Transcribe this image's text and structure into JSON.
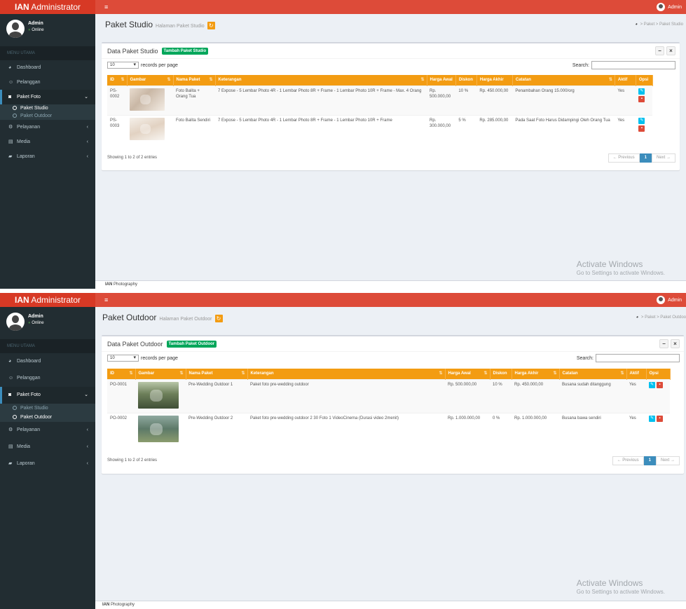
{
  "app": {
    "brand_bold": "IAN",
    "brand_rest": " Administrator",
    "hamburger": "≡",
    "top_user": "Admin"
  },
  "sidebar": {
    "user_name": "Admin",
    "user_status": "Online",
    "header": "MENU UTAMA",
    "items": {
      "dashboard": "Dashboard",
      "pelanggan": "Pelanggan",
      "paket_foto": "Paket Foto",
      "paket_studio": "Paket Studio",
      "paket_outdoor": "Paket Outdoor",
      "pelayanan": "Pelayanan",
      "media": "Media",
      "laporan": "Laporan"
    }
  },
  "common": {
    "records_per_page": "records per page",
    "length_value": "10",
    "search_label": "Search:",
    "minimize": "−",
    "close": "×",
    "previous": "← Previous",
    "next": "Next →",
    "page": "1",
    "bc_paket": "Paket",
    "watermark_title": "Activate Windows",
    "watermark_sub": "Go to Settings to activate Windows.",
    "footer_bold": "IAN",
    "footer_rest": " Photography"
  },
  "studio": {
    "title": "Paket Studio",
    "subtitle": "Halaman Paket Studio",
    "breadcrumb_last": "Paket Studio",
    "box_title": "Data Paket Studio",
    "add_button": "Tambah Paket Studio",
    "columns": [
      "ID",
      "Gambar",
      "Nama Paket",
      "Keterangan",
      "Harga Awal",
      "Diskon",
      "Harga Akhir",
      "Catatan",
      "Aktif",
      "Opsi"
    ],
    "rows": [
      {
        "id": "PS-0002",
        "nama": "Foto Balita + Orang Tua",
        "keterangan": "7 Expose - 5 Lembar Photo 4R - 1 Lembar Photo 8R + Frame - 1 Lembar Photo 10R + Frame - Max. 4 Orang",
        "harga_awal": "Rp. 500.000,00",
        "diskon": "10 %",
        "harga_akhir": "Rp. 450.000,00",
        "catatan": "Penambahan Orang 15.000/org",
        "aktif": "Yes"
      },
      {
        "id": "PS-0003",
        "nama": "Foto Balita Sendiri",
        "keterangan": "7 Expose - 5 Lembar Photo 4R - 1 Lembar Photo 8R + Frame - 1 Lembar Photo 10R + Frame",
        "harga_awal": "Rp. 300.000,00",
        "diskon": "5 %",
        "harga_akhir": "Rp. 285.000,00",
        "catatan": "Pada Saat Foto Harus Didampingi Oleh Orang Tua",
        "aktif": "Yes"
      }
    ],
    "info": "Showing 1 to 2 of 2 entries"
  },
  "outdoor": {
    "title": "Paket Outdoor",
    "subtitle": "Halaman Paket Outdoor",
    "breadcrumb_last": "Paket Outdoo",
    "box_title": "Data Paket Outdoor",
    "add_button": "Tambah Paket Outdoor",
    "columns": [
      "ID",
      "Gambar",
      "Nama Paket",
      "Keterangan",
      "Harga Awal",
      "Diskon",
      "Harga Akhir",
      "Catatan",
      "Aktif",
      "Opsi"
    ],
    "rows": [
      {
        "id": "PO-0001",
        "nama": "Pre-Wedding Outdoor 1",
        "keterangan": "Paket foto pre-wedding outdoor",
        "harga_awal": "Rp. 500.000,00",
        "diskon": "10 %",
        "harga_akhir": "Rp. 450.000,00",
        "catatan": "Busana sudah ditanggung",
        "aktif": "Yes"
      },
      {
        "id": "PO-0002",
        "nama": "Pre-Wedding Outdoor 2",
        "keterangan": "Paket foto pre-wedding outdoor 2 30 Foto 1 VideoCinema (Durasi video 2menit)",
        "harga_awal": "Rp. 1.000.000,00",
        "diskon": "0 %",
        "harga_akhir": "Rp. 1.000.000,00",
        "catatan": "Busana bawa sendiri",
        "aktif": "Yes"
      }
    ],
    "info": "Showing 1 to 2 of 2 entries"
  },
  "colors": {
    "header": "#dd4b39",
    "sidebar": "#222d32",
    "table_head": "#f39c12",
    "add_button": "#00a65a"
  }
}
